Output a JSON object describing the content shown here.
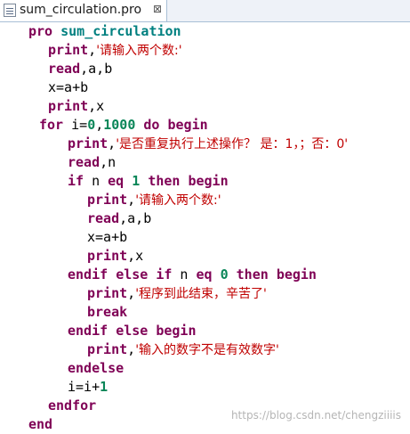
{
  "tab": {
    "label": "sum_circulation.pro",
    "close": "⊠"
  },
  "code": [
    {
      "indent": 32,
      "tokens": [
        {
          "t": "pro",
          "c": "kw"
        },
        {
          "t": " "
        },
        {
          "t": "sum_circulation",
          "c": "pname"
        }
      ]
    },
    {
      "indent": 54,
      "tokens": [
        {
          "t": "print",
          "c": "kw"
        },
        {
          "t": ","
        },
        {
          "t": "'请输入两个数:'",
          "c": "str"
        }
      ]
    },
    {
      "indent": 54,
      "tokens": [
        {
          "t": "read",
          "c": "kw"
        },
        {
          "t": ",a,b"
        }
      ]
    },
    {
      "indent": 54,
      "tokens": [
        {
          "t": "x=a+b"
        }
      ]
    },
    {
      "indent": 54,
      "tokens": [
        {
          "t": "print",
          "c": "kw"
        },
        {
          "t": ",x"
        }
      ]
    },
    {
      "indent": 44,
      "tokens": [
        {
          "t": "for",
          "c": "kw"
        },
        {
          "t": " i="
        },
        {
          "t": "0",
          "c": "nm"
        },
        {
          "t": ","
        },
        {
          "t": "1000",
          "c": "nm"
        },
        {
          "t": " "
        },
        {
          "t": "do",
          "c": "kw"
        },
        {
          "t": " "
        },
        {
          "t": "begin",
          "c": "kw"
        }
      ]
    },
    {
      "indent": 76,
      "tokens": [
        {
          "t": "print",
          "c": "kw"
        },
        {
          "t": ","
        },
        {
          "t": "'是否重复执行上述操作？ 是：1，；否：0'",
          "c": "str"
        }
      ]
    },
    {
      "indent": 76,
      "tokens": [
        {
          "t": "read",
          "c": "kw"
        },
        {
          "t": ",n"
        }
      ]
    },
    {
      "indent": 76,
      "tokens": [
        {
          "t": "if",
          "c": "kw"
        },
        {
          "t": " n "
        },
        {
          "t": "eq",
          "c": "kw"
        },
        {
          "t": " "
        },
        {
          "t": "1",
          "c": "nm"
        },
        {
          "t": " "
        },
        {
          "t": "then",
          "c": "kw"
        },
        {
          "t": " "
        },
        {
          "t": "begin",
          "c": "kw"
        }
      ]
    },
    {
      "indent": 98,
      "tokens": [
        {
          "t": "print",
          "c": "kw"
        },
        {
          "t": ","
        },
        {
          "t": "'请输入两个数:'",
          "c": "str"
        }
      ]
    },
    {
      "indent": 98,
      "tokens": [
        {
          "t": "read",
          "c": "kw"
        },
        {
          "t": ",a,b"
        }
      ]
    },
    {
      "indent": 98,
      "tokens": [
        {
          "t": "x=a+b"
        }
      ]
    },
    {
      "indent": 98,
      "tokens": [
        {
          "t": "print",
          "c": "kw"
        },
        {
          "t": ",x"
        }
      ]
    },
    {
      "indent": 76,
      "tokens": [
        {
          "t": "endif",
          "c": "kw"
        },
        {
          "t": " "
        },
        {
          "t": "else",
          "c": "kw"
        },
        {
          "t": " "
        },
        {
          "t": "if",
          "c": "kw"
        },
        {
          "t": " n "
        },
        {
          "t": "eq",
          "c": "kw"
        },
        {
          "t": " "
        },
        {
          "t": "0",
          "c": "nm"
        },
        {
          "t": " "
        },
        {
          "t": "then",
          "c": "kw"
        },
        {
          "t": " "
        },
        {
          "t": "begin",
          "c": "kw"
        }
      ]
    },
    {
      "indent": 98,
      "tokens": [
        {
          "t": "print",
          "c": "kw"
        },
        {
          "t": ","
        },
        {
          "t": "'程序到此结束，辛苦了'",
          "c": "str"
        }
      ]
    },
    {
      "indent": 98,
      "tokens": [
        {
          "t": "break",
          "c": "kw"
        }
      ]
    },
    {
      "indent": 76,
      "tokens": [
        {
          "t": "endif",
          "c": "kw"
        },
        {
          "t": " "
        },
        {
          "t": "else",
          "c": "kw"
        },
        {
          "t": " "
        },
        {
          "t": "begin",
          "c": "kw"
        }
      ]
    },
    {
      "indent": 98,
      "tokens": [
        {
          "t": "print",
          "c": "kw"
        },
        {
          "t": ","
        },
        {
          "t": "'输入的数字不是有效数字'",
          "c": "str"
        }
      ]
    },
    {
      "indent": 76,
      "tokens": [
        {
          "t": "endelse",
          "c": "kw"
        }
      ]
    },
    {
      "indent": 76,
      "tokens": [
        {
          "t": "i=i+"
        },
        {
          "t": "1",
          "c": "nm"
        }
      ]
    },
    {
      "indent": 54,
      "tokens": [
        {
          "t": "endfor",
          "c": "kw"
        }
      ]
    },
    {
      "indent": 32,
      "tokens": [
        {
          "t": "end",
          "c": "kw"
        }
      ]
    }
  ],
  "watermark": "https://blog.csdn.net/chengziiiis",
  "colors": {
    "keyword": "#7f0055",
    "number": "#098658",
    "string": "#c00000",
    "procname": "#008080"
  }
}
